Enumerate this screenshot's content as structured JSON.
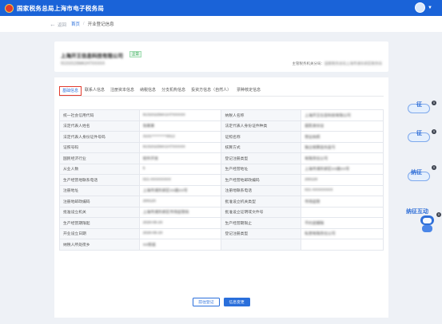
{
  "header": {
    "title": "国家税务总局上海市电子税务局"
  },
  "breadcrumb": {
    "back": "返回",
    "home": "首页",
    "current": "开业登记信息"
  },
  "company": {
    "name": "上海开王信息科技有限公司",
    "status_tag": "正常",
    "code": "91310115MA1H7XXXXX",
    "authority_label": "主管税务机关分局：",
    "authority_value": "国家税务总局上海市浦东新区税务局"
  },
  "tabs": [
    {
      "label": "基础信息"
    },
    {
      "label": "联系人信息"
    },
    {
      "label": "注册资本信息"
    },
    {
      "label": "纳税信息"
    },
    {
      "label": "分支机构信息"
    },
    {
      "label": "投资方信息（自然人）"
    },
    {
      "label": "票种核定信息"
    }
  ],
  "rows": [
    {
      "l1": "统一社会信用代码",
      "v1": "91310115MA1H7XXXXX",
      "l2": "纳税人名称",
      "v2": "上海开王信息科技有限公司"
    },
    {
      "l1": "法定代表人姓名",
      "v1": "张某某",
      "l2": "法定代表人身份证件种类",
      "v2": "居民身份证"
    },
    {
      "l1": "法定代表人身份证件号码",
      "v1": "3101**********0012",
      "l2": "证照名称",
      "v2": "营业执照"
    },
    {
      "l1": "证照号码",
      "v1": "91310115MA1H7XXXXX",
      "l2": "核算方式",
      "v2": "独立核算自负盈亏"
    },
    {
      "l1": "国民经济行业",
      "v1": "软件开发",
      "l2": "登记注册类型",
      "v2": "有限责任公司"
    },
    {
      "l1": "从业人数",
      "v1": "5",
      "l2": "生产经营地址",
      "v2": "上海市浦东新区XX路XX号"
    },
    {
      "l1": "生产经营地联系电话",
      "v1": "021-XXXXXXXX",
      "l2": "生产经营地邮政编码",
      "v2": "200120"
    },
    {
      "l1": "注册地址",
      "v1": "上海市浦东新区XX路XX号",
      "l2": "注册地联系电话",
      "v2": "021-XXXXXXXX"
    },
    {
      "l1": "注册地邮政编码",
      "v1": "200120",
      "l2": "批准设立机关类型",
      "v2": "市场监管"
    },
    {
      "l1": "批准设立机关",
      "v1": "上海市浦东新区市场监管局",
      "l2": "批准设立证明或文件号",
      "v2": ""
    },
    {
      "l1": "生产经营期限起",
      "v1": "2020-05-20",
      "l2": "生产经营期限止",
      "v2": "不约定期限"
    },
    {
      "l1": "开业设立日期",
      "v1": "2020-05-20",
      "l2": "登记注册类型",
      "v2": "私营有限责任公司"
    },
    {
      "l1": "纳税人所处街乡",
      "v1": "XX街道",
      "l2": "",
      "v2": ""
    }
  ],
  "actions": {
    "secondary": "前往登记",
    "primary": "信息变更"
  },
  "side_widgets": [
    {
      "label": "征",
      "badge": "0"
    },
    {
      "label": "征",
      "badge": "0"
    },
    {
      "label": "纳征",
      "badge": "0"
    },
    {
      "label": "纳征互动",
      "badge": "0"
    }
  ],
  "colors": {
    "brand": "#1a63d8",
    "accent": "#2a6fdb",
    "status": "#24a148"
  }
}
